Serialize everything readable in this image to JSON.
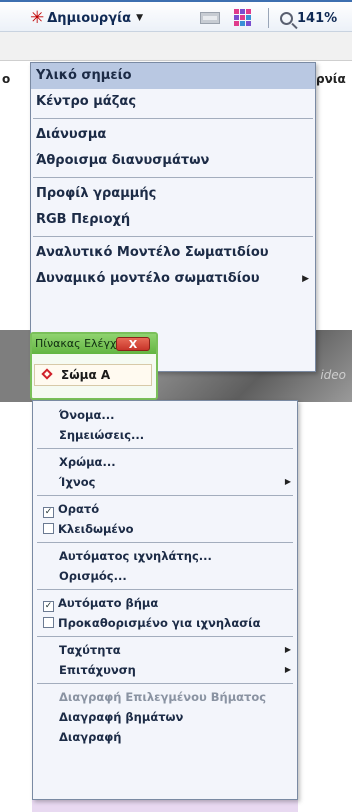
{
  "toolbar": {
    "create_label": "Δημιουργία",
    "zoom_level": "141%"
  },
  "background": {
    "left_fragment": "ο",
    "right_fragment": "ρνία",
    "watermark": "ideo"
  },
  "create_menu": {
    "groups": [
      [
        "Υλικό σημείο",
        "Κέντρο μάζας"
      ],
      [
        "Διάνυσμα",
        "Άθροισμα διανυσμάτων"
      ],
      [
        "Προφίλ γραμμής",
        "RGB Περιοχή"
      ],
      [
        "Αναλυτικό Μοντέλο Σωματιδίου",
        "Δυναμικό μοντέλο σωματιδίου"
      ]
    ],
    "selected": "Υλικό σημείο",
    "submenu_item": "Δυναμικό μοντέλο σωματιδίου"
  },
  "control_panel": {
    "title": "Πίνακας Ελέγχο...",
    "close_glyph": "X",
    "track_name": "Σώμα Α"
  },
  "context_menu": {
    "name": "Όνομα...",
    "notes": "Σημειώσεις...",
    "color": "Χρώμα...",
    "trace": "Ίχνος",
    "visible": "Ορατό",
    "visible_checked": true,
    "locked": "Κλειδωμένο",
    "locked_checked": false,
    "autotracker": "Αυτόματος ιχνηλάτης...",
    "define": "Ορισμός...",
    "autostep": "Αυτόματο βήμα",
    "autostep_checked": true,
    "preset": "Προκαθορισμένο για ιχνηλασία",
    "preset_checked": false,
    "velocity": "Ταχύτητα",
    "acceleration": "Επιτάχυνση",
    "delete_selected_step": "Διαγραφή Επιλεγμένου Βήματος",
    "delete_steps": "Διαγραφή βημάτων",
    "delete": "Διαγραφή"
  },
  "colors": {
    "accent": "#3d6fb0",
    "selection": "#b9c8e2",
    "panel_green": "#7ac05a",
    "close_red": "#c7352a",
    "diamond_red": "#d0202a"
  }
}
